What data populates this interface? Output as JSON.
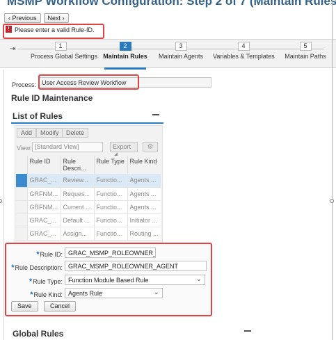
{
  "page": {
    "title": "MSMP Workflow Configuration: Step 2  of 7  (Maintain Rules)"
  },
  "nav": {
    "previous_label": "Previous",
    "next_label": "Next"
  },
  "message": {
    "icon": "error-icon",
    "icon_glyph": "!",
    "text": "Please enter a valid Rule-ID.",
    "color": "#c8202b"
  },
  "roadmap": {
    "steps": [
      {
        "number": "1",
        "label": "Process Global Settings",
        "active": false
      },
      {
        "number": "2",
        "label": "Maintain Rules",
        "active": true
      },
      {
        "number": "3",
        "label": "Maintain Agents",
        "active": false
      },
      {
        "number": "4",
        "label": "Variables & Templates",
        "active": false
      },
      {
        "number": "5",
        "label": "Maintain Paths",
        "active": false
      }
    ],
    "accent": "#2a7ac0"
  },
  "process": {
    "label": "Process:",
    "value": "User Access Review Workflow"
  },
  "rule_id_section": {
    "title": "Rule ID Maintenance"
  },
  "list_of_rules": {
    "title": "List of Rules",
    "toolbar": {
      "add": "Add",
      "modify": "Modify",
      "delete": "Delete"
    },
    "view_label": "View:",
    "view_value": "[Standard View]",
    "export_label": "Export",
    "columns": [
      "Rule ID",
      "Rule Descri...",
      "Rule Type",
      "Rule Kind"
    ],
    "rows": [
      [
        "GRAC_...",
        "Review...",
        "Functio...",
        "Agents ..."
      ],
      [
        "GRFNM...",
        "Reques...",
        "Functio...",
        "Agents ..."
      ],
      [
        "GRFNM...",
        "Current ...",
        "Functio...",
        "Agents ..."
      ],
      [
        "GRAC_...",
        "Default ...",
        "Functio...",
        "Initiator ..."
      ],
      [
        "GRAC_...",
        "Assign...",
        "Functio...",
        "Routing ..."
      ]
    ]
  },
  "form": {
    "rule_id_label": "Rule ID:",
    "rule_id_value": "GRAC_MSMP_ROLEOWNER_AC",
    "rule_desc_label": "Rule Description:",
    "rule_desc_value": "GRAC_MSMP_ROLEOWNER_AGENT",
    "rule_type_label": "Rule Type:",
    "rule_type_value": "Function Module Based Rule",
    "rule_kind_label": "Rule Kind:",
    "rule_kind_value": "Agents Rule",
    "save_label": "Save",
    "cancel_label": "Cancel"
  },
  "global_rules": {
    "title": "Global Rules"
  }
}
